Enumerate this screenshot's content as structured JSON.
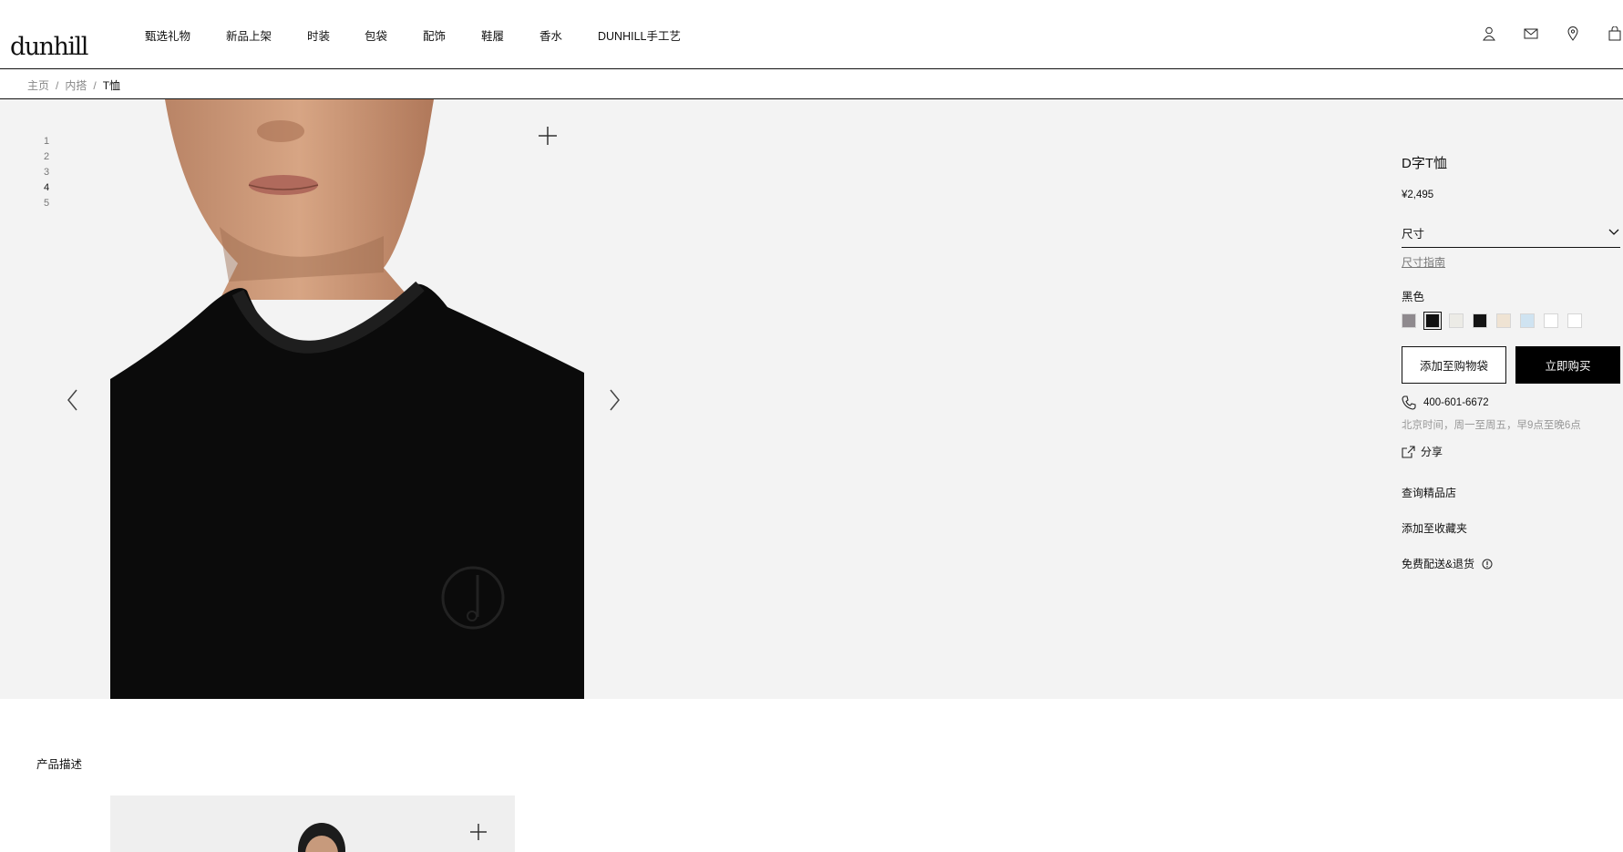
{
  "brand": {
    "logo_text": "dunhill"
  },
  "nav": {
    "items": [
      {
        "label": "甄选礼物"
      },
      {
        "label": "新品上架"
      },
      {
        "label": "时装"
      },
      {
        "label": "包袋"
      },
      {
        "label": "配饰"
      },
      {
        "label": "鞋履"
      },
      {
        "label": "香水"
      },
      {
        "label": "DUNHILL手工艺"
      }
    ]
  },
  "header_icons": [
    "account-icon",
    "mail-icon",
    "location-icon",
    "bag-icon"
  ],
  "breadcrumb": {
    "home": "主页",
    "category": "内搭",
    "current": "T恤",
    "separator": "/"
  },
  "gallery": {
    "pages": [
      "1",
      "2",
      "3",
      "4",
      "5"
    ],
    "active_index": 3
  },
  "product": {
    "title": "D字T恤",
    "price": "¥2,495",
    "size_label": "尺寸",
    "size_guide": "尺寸指南",
    "color_label": "黑色",
    "swatches": [
      {
        "color": "#8f8a8e"
      },
      {
        "color": "#111111"
      },
      {
        "color": "#ecebe6"
      },
      {
        "color": "#141414"
      },
      {
        "color": "#efe3d3"
      },
      {
        "color": "#cfe3f1"
      },
      {
        "color": "#ffffff"
      },
      {
        "color": "#ffffff"
      }
    ],
    "add_to_bag": "添加至购物袋",
    "buy_now": "立即购买",
    "phone": "400-601-6672",
    "hours": "北京时间，周一至周五，早9点至晚6点",
    "share": "分享",
    "find_store": "查询精品店",
    "add_wishlist": "添加至收藏夹",
    "shipping": "免费配送&退货"
  },
  "description": {
    "title": "产品描述"
  },
  "colors": {
    "stage_bg": "#f3f3f3",
    "text": "#111111",
    "muted": "#888888"
  }
}
